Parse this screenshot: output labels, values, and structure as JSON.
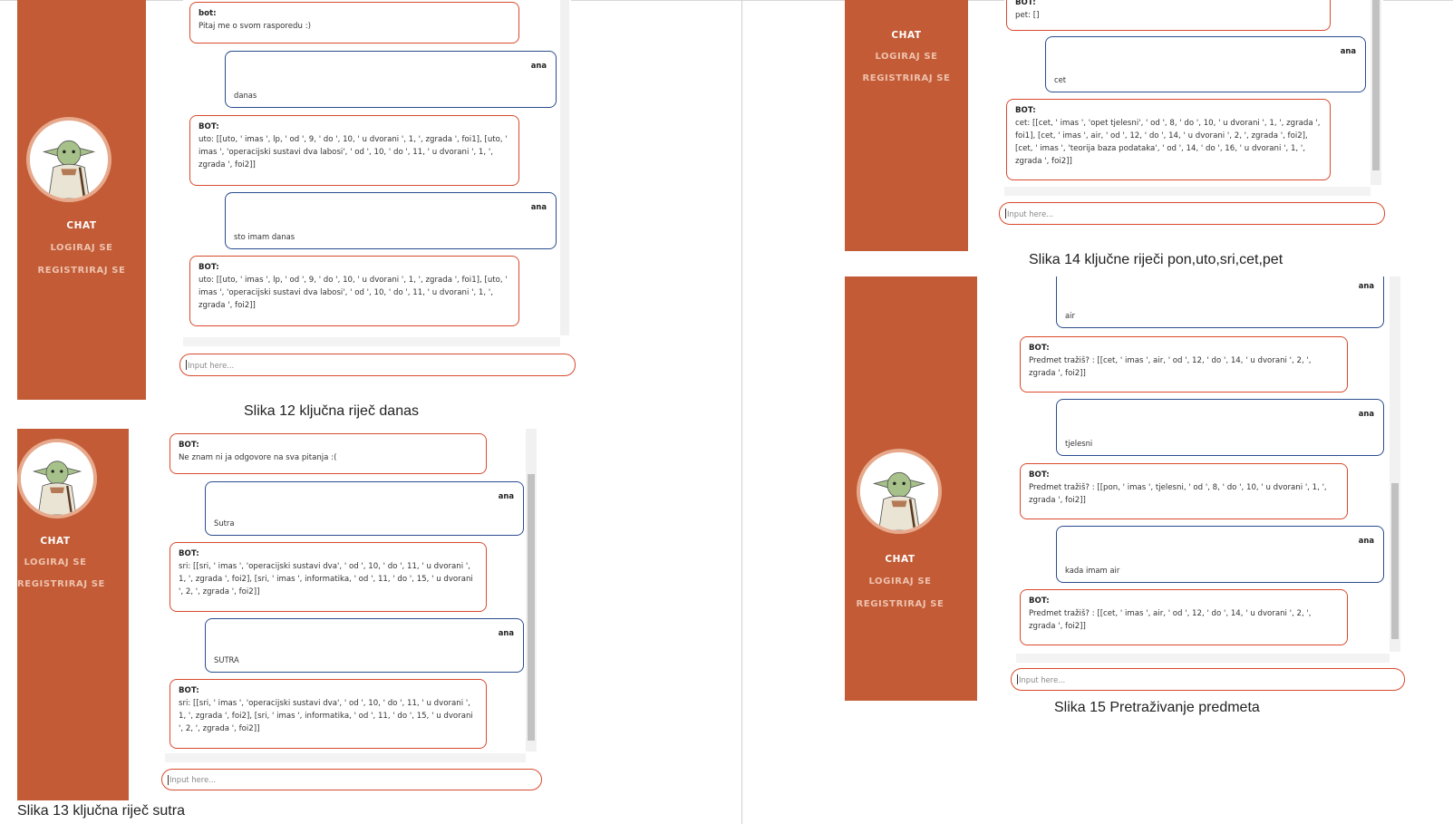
{
  "nav": {
    "chat": "CHAT",
    "login": "LOGIRAJ SE",
    "register": "REGISTRIRAJ SE"
  },
  "input_placeholder": "Input here...",
  "user_name": "ana",
  "captions": {
    "fig12": "Slika 12 ključna riječ danas",
    "fig13": "Slika 13 ključna riječ sutra",
    "fig14": "Slika 14 ključne riječi pon,uto,sri,cet,pet",
    "fig15": "Slika 15 Pretraživanje predmeta"
  },
  "fig12": {
    "m1_sender": "bot:",
    "m1_text": "Pitaj me o svom rasporedu :)",
    "m2_text": "danas",
    "m3_sender": "BOT:",
    "m3_text": "uto: [[uto, ' imas ', lp, ' od ', 9, ' do ', 10, ' u dvorani ', 1, ', zgrada ', foi1], [uto, ' imas ', 'operacijski sustavi dva labosi', ' od ', 10, ' do ', 11, ' u dvorani ', 1, ', zgrada ', foi2]]",
    "m4_text": "sto imam danas",
    "m5_sender": "BOT:",
    "m5_text": "uto: [[uto, ' imas ', lp, ' od ', 9, ' do ', 10, ' u dvorani ', 1, ', zgrada ', foi1], [uto, ' imas ', 'operacijski sustavi dva labosi', ' od ', 10, ' do ', 11, ' u dvorani ', 1, ', zgrada ', foi2]]"
  },
  "fig13": {
    "m1_sender": "BOT:",
    "m1_text": "Ne znam ni ja odgovore na sva pitanja :(",
    "m2_text": "Sutra",
    "m3_sender": "BOT:",
    "m3_text": "sri: [[sri, ' imas ', 'operacijski sustavi dva', ' od ', 10, ' do ', 11, ' u dvorani ', 1, ', zgrada ', foi2], [sri, ' imas ', informatika, ' od ', 11, ' do ', 15, ' u dvorani ', 2, ', zgrada ', foi2]]",
    "m4_text": "SUTRA",
    "m5_sender": "BOT:",
    "m5_text": "sri: [[sri, ' imas ', 'operacijski sustavi dva', ' od ', 10, ' do ', 11, ' u dvorani ', 1, ', zgrada ', foi2], [sri, ' imas ', informatika, ' od ', 11, ' do ', 15, ' u dvorani ', 2, ', zgrada ', foi2]]"
  },
  "fig14": {
    "m1_sender": "BOT:",
    "m1_text": "pet: []",
    "m2_text": "cet",
    "m3_sender": "BOT:",
    "m3_text": "cet: [[cet, ' imas ', 'opet tjelesni', ' od ', 8, ' do ', 10, ' u dvorani ', 1, ', zgrada ', foi1], [cet, ' imas ', air, ' od ', 12, ' do ', 14, ' u dvorani ', 2, ', zgrada ', foi2], [cet, ' imas ', 'teorija baza podataka', ' od ', 14, ' do ', 16, ' u dvorani ', 1, ', zgrada ', foi2]]"
  },
  "fig15": {
    "m1_text": "air",
    "m2_sender": "BOT:",
    "m2_text": "Predmet tražiš? : [[cet, ' imas ', air, ' od ', 12, ' do ', 14, ' u dvorani ', 2, ', zgrada ', foi2]]",
    "m3_text": "tjelesni",
    "m4_sender": "BOT:",
    "m4_text": "Predmet tražiš? : [[pon, ' imas ', tjelesni, ' od ', 8, ' do ', 10, ' u dvorani ', 1, ', zgrada ', foi2]]",
    "m5_text": "kada imam air",
    "m6_sender": "BOT:",
    "m6_text": "Predmet tražiš? : [[cet, ' imas ', air, ' od ', 12, ' do ', 14, ' u dvorani ', 2, ', zgrada ', foi2]]"
  },
  "colors": {
    "sidebar": "#c25b36",
    "bot_border": "#d94a2c",
    "user_border": "#2a4c8e"
  },
  "icons": {
    "avatar": "yoda-avatar-icon"
  }
}
